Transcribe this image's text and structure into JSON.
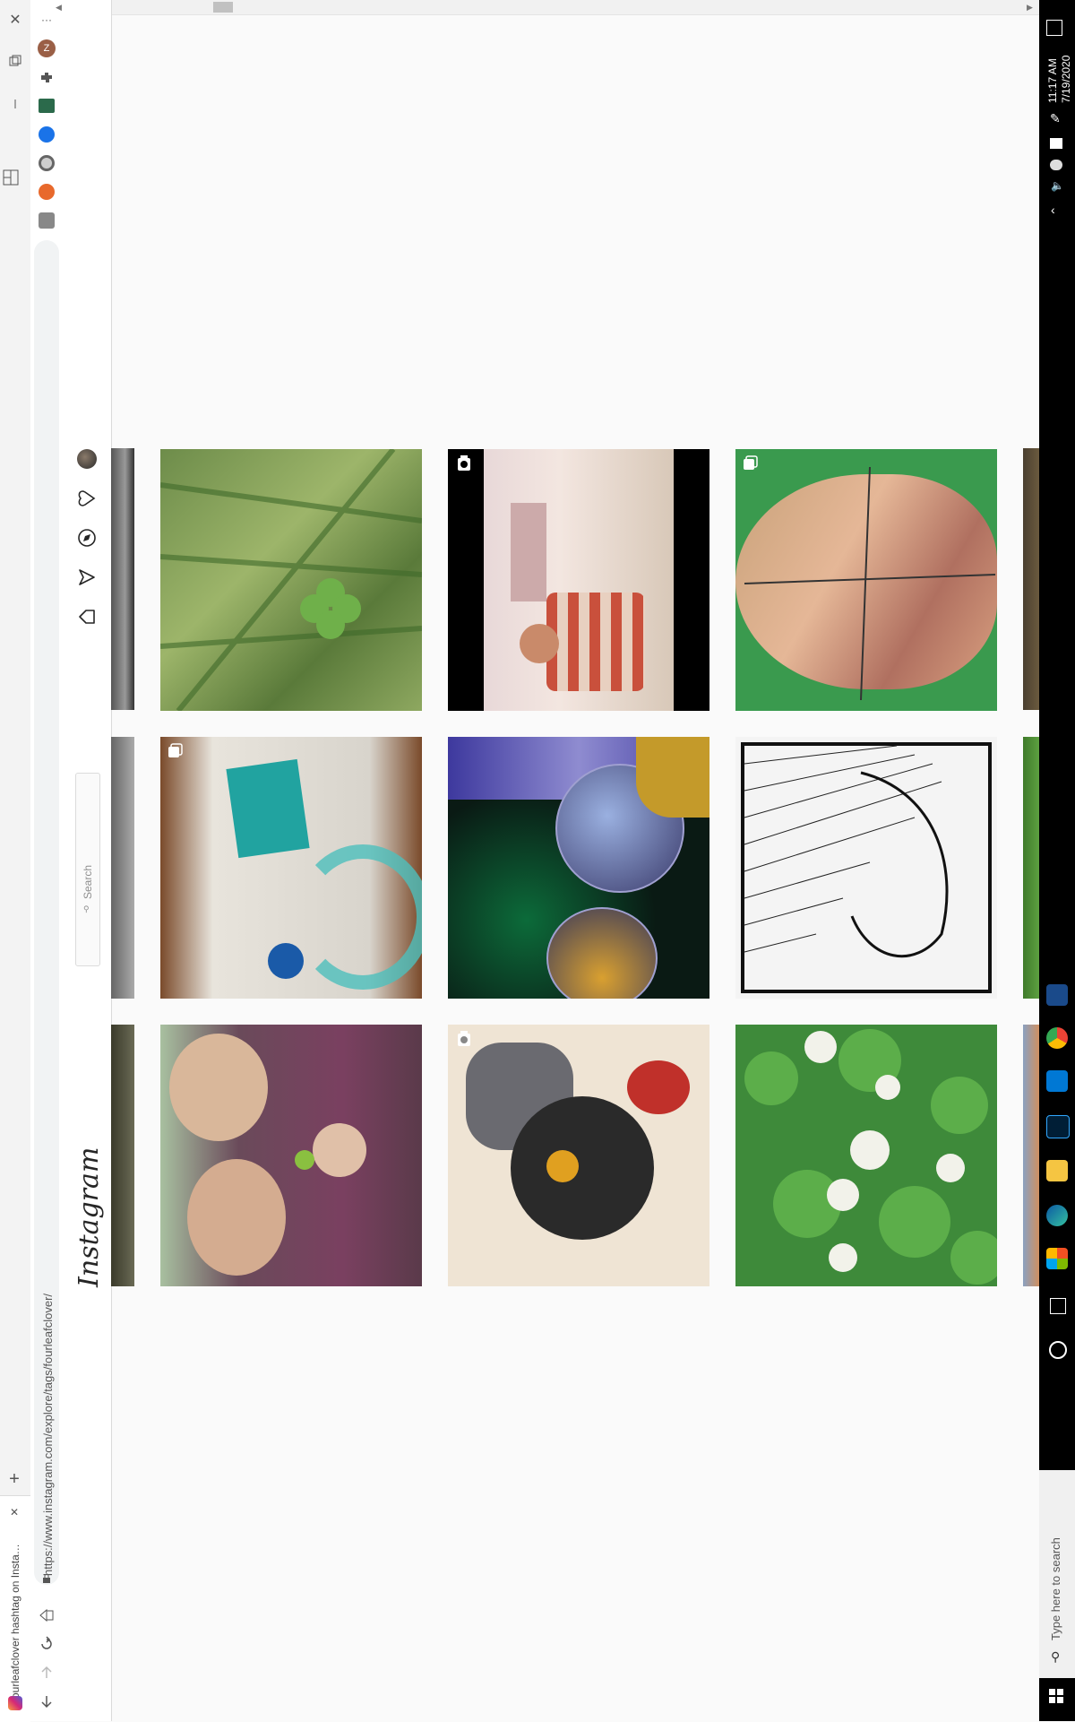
{
  "browser": {
    "tab_title": "#fourleafclover hashtag on Insta…",
    "address": "https://www.instagram.com/explore/tags/fourleafclover/",
    "new_tab_label": "+",
    "tab_close_label": "✕",
    "window_close_label": "✕",
    "menu_label": "···",
    "profile_initial": "Z"
  },
  "instagram": {
    "logo": "Instagram",
    "search_placeholder": "Search"
  },
  "posts": [
    {
      "alt": "four leaf clover in grass",
      "badge": "none"
    },
    {
      "alt": "woman in striped top",
      "badge": "camera"
    },
    {
      "alt": "cut-out face collage on green",
      "badge": "square"
    },
    {
      "alt": "collage on newspaper",
      "badge": "square"
    },
    {
      "alt": "glass hourglass",
      "badge": "none"
    },
    {
      "alt": "ink drawing of hands",
      "badge": "none"
    },
    {
      "alt": "man holding four leaf clover",
      "badge": "none"
    },
    {
      "alt": "tattoo flash illustration",
      "badge": "camera"
    },
    {
      "alt": "white clover flowers",
      "badge": "none"
    }
  ],
  "taskbar": {
    "time": "11:17 AM",
    "date": "7/19/2020",
    "search_placeholder": "Type here to search"
  },
  "colors": {
    "accent_blue": "#1a73e8",
    "instagram_bg": "#fafafa"
  }
}
